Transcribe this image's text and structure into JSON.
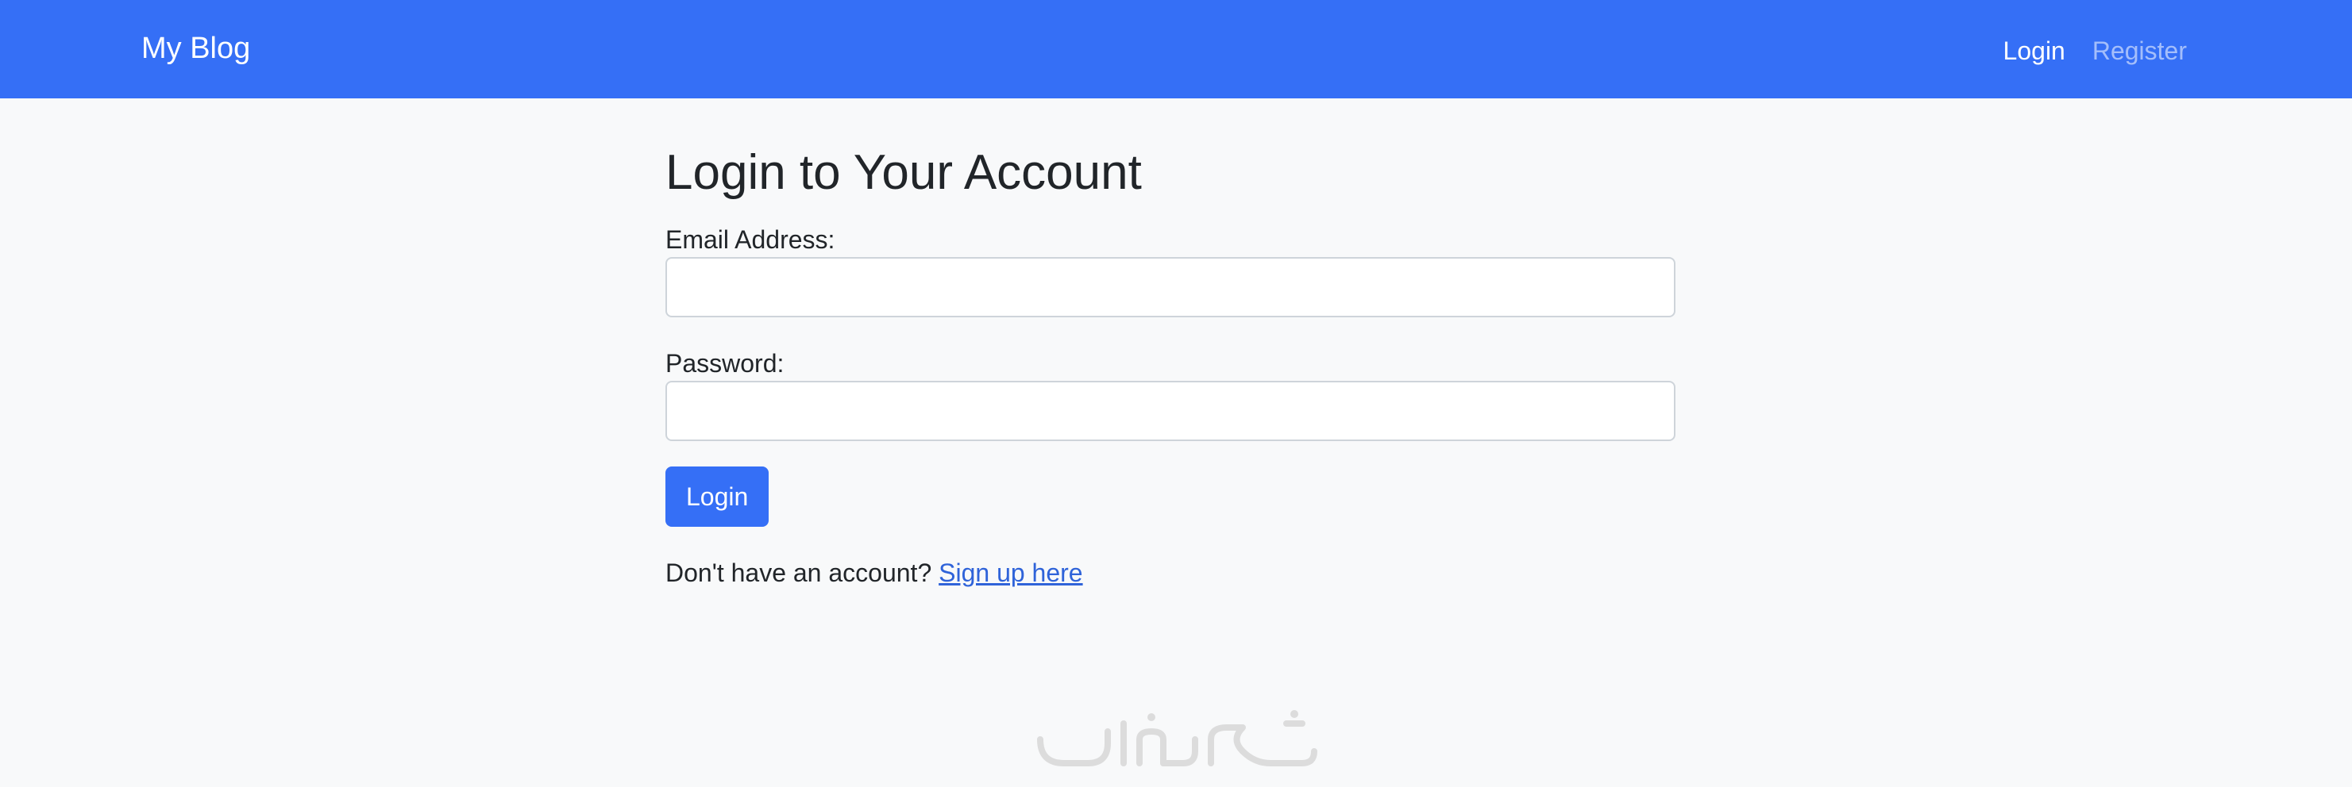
{
  "navbar": {
    "brand": "My Blog",
    "links": [
      {
        "label": "Login",
        "active": true
      },
      {
        "label": "Register",
        "active": false
      }
    ]
  },
  "main": {
    "title": "Login to Your Account",
    "form": {
      "email_label": "Email Address:",
      "email_value": "",
      "password_label": "Password:",
      "password_value": "",
      "submit_label": "Login"
    },
    "signup": {
      "prompt": "Don't have an account?",
      "link_label": "Sign up here"
    }
  },
  "colors": {
    "navbar_bg": "#356ff6",
    "page_bg": "#f8f9fa",
    "button_bg": "#356ff6",
    "link": "#2f63d9"
  },
  "watermark": "خمسات"
}
